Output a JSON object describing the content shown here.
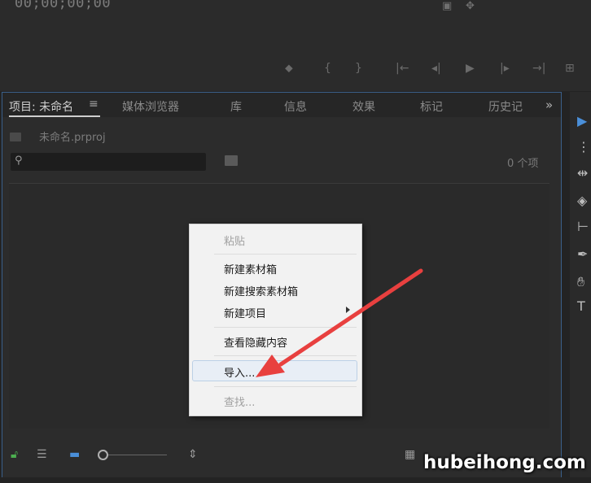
{
  "monitor": {
    "timecode": "00;00;00;00"
  },
  "project_panel": {
    "tabs": [
      {
        "label": "项目: 未命名",
        "active": true
      },
      {
        "label": "媒体浏览器"
      },
      {
        "label": "库"
      },
      {
        "label": "信息"
      },
      {
        "label": "效果"
      },
      {
        "label": "标记"
      },
      {
        "label": "历史记"
      }
    ],
    "tab_menu_glyph": "≡",
    "overflow_glyph": "»",
    "project_file": "未命名.prproj",
    "search_placeholder": "",
    "item_count": "0 个项"
  },
  "context_menu": {
    "items": [
      {
        "label": "粘贴",
        "disabled": true
      },
      {
        "label": "新建素材箱"
      },
      {
        "label": "新建搜索素材箱"
      },
      {
        "label": "新建项目",
        "submenu": true
      },
      {
        "label": "查看隐藏内容"
      },
      {
        "label": "导入...",
        "highlighted": true
      },
      {
        "label": "查找...",
        "disabled": true
      }
    ]
  },
  "colors": {
    "accent": "#3a5f8a",
    "arrow": "#e8403f",
    "menu_bg": "#f2f2f2"
  },
  "watermark": "hubeihong.com"
}
